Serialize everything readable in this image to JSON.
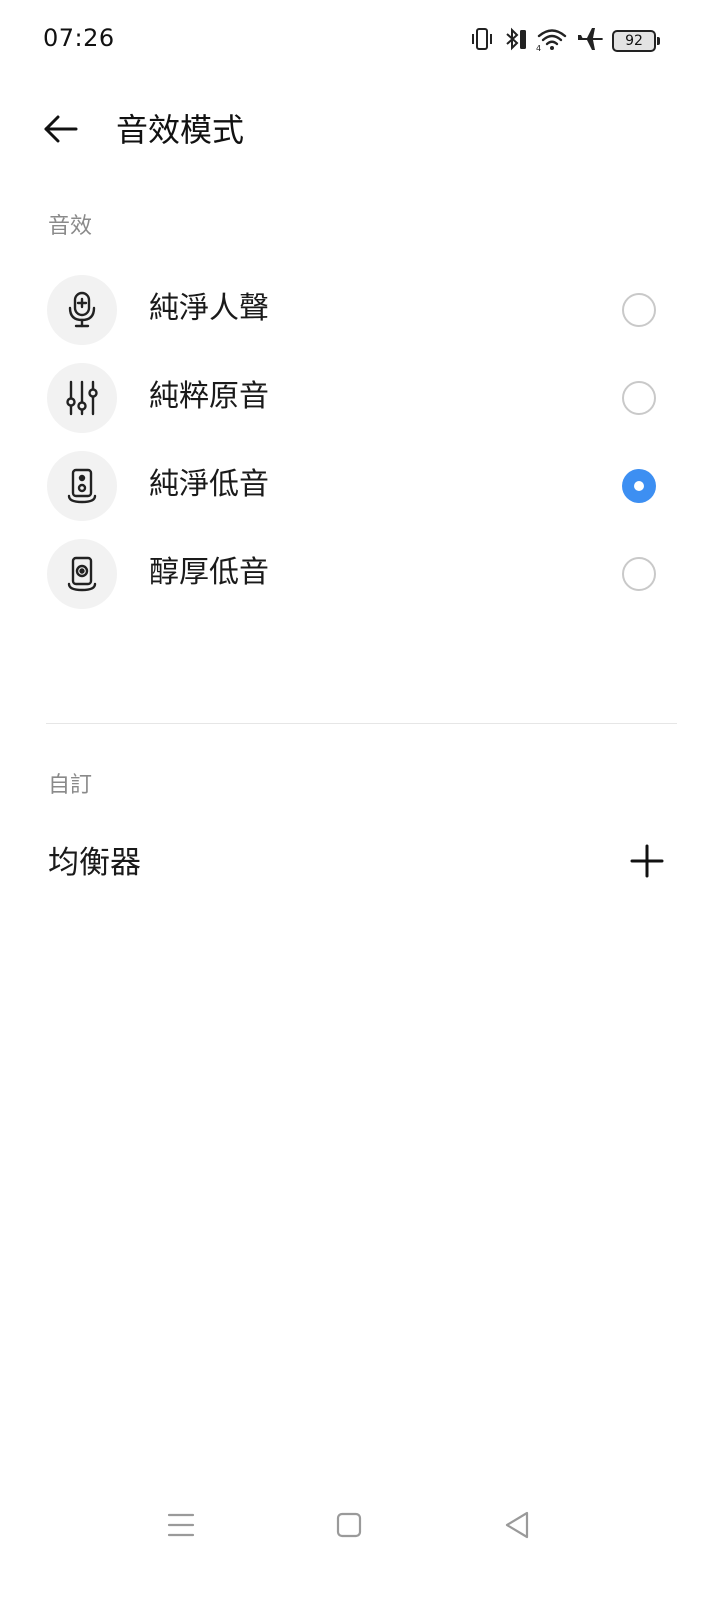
{
  "status_bar": {
    "time": "07:26",
    "battery_level": "92",
    "icons": [
      "vibrate-icon",
      "bluetooth-icon",
      "wifi-icon",
      "airplane-icon",
      "battery-icon"
    ]
  },
  "header": {
    "title": "音效模式",
    "back_icon": "arrow-left-icon"
  },
  "sound_effects": {
    "section_label": "音效",
    "items": [
      {
        "label": "純淨人聲",
        "icon": "microphone-icon",
        "selected": false
      },
      {
        "label": "純粹原音",
        "icon": "equalizer-sliders-icon",
        "selected": false
      },
      {
        "label": "純淨低音",
        "icon": "speaker-icon",
        "selected": true
      },
      {
        "label": "醇厚低音",
        "icon": "speaker-round-icon",
        "selected": false
      }
    ]
  },
  "custom": {
    "section_label": "自訂",
    "equalizer_label": "均衡器",
    "add_icon": "plus-icon"
  },
  "nav_bar": {
    "icons": [
      "menu-icon",
      "home-square-icon",
      "back-triangle-icon"
    ]
  },
  "colors": {
    "accent": "#3d8ff2",
    "icon_circle_bg": "#f2f2f2",
    "section_label": "#8a8a8a",
    "radio_border": "#c9c9c9"
  }
}
